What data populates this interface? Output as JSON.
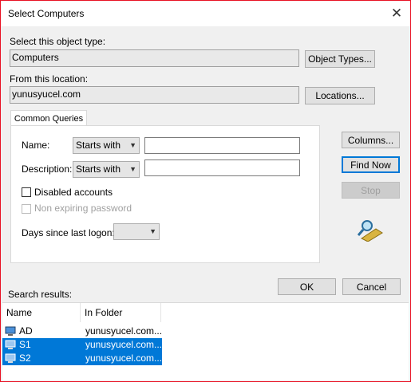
{
  "window": {
    "title": "Select Computers"
  },
  "object_type": {
    "label": "Select this object type:",
    "value": "Computers",
    "button": "Object Types..."
  },
  "location": {
    "label": "From this location:",
    "value": "yunusyucel.com",
    "button": "Locations..."
  },
  "tab": {
    "label": "Common Queries"
  },
  "queries": {
    "name_label": "Name:",
    "name_mode": "Starts with",
    "name_value": "",
    "description_label": "Description:",
    "description_mode": "Starts with",
    "description_value": "",
    "disabled_accounts": "Disabled accounts",
    "non_expiring_password": "Non expiring password",
    "days_label": "Days since last logon:",
    "days_value": ""
  },
  "buttons": {
    "columns": "Columns...",
    "find_now": "Find Now",
    "stop": "Stop",
    "ok": "OK",
    "cancel": "Cancel"
  },
  "results": {
    "label": "Search results:",
    "columns": [
      "Name",
      "In Folder"
    ],
    "rows": [
      {
        "name": "AD",
        "folder": "yunusyucel.com...",
        "selected": false
      },
      {
        "name": "S1",
        "folder": "yunusyucel.com...",
        "selected": true
      },
      {
        "name": "S2",
        "folder": "yunusyucel.com...",
        "selected": true
      }
    ]
  },
  "icons": {
    "close": "close-icon",
    "search": "magnifier-search-icon",
    "computer": "computer-icon"
  }
}
